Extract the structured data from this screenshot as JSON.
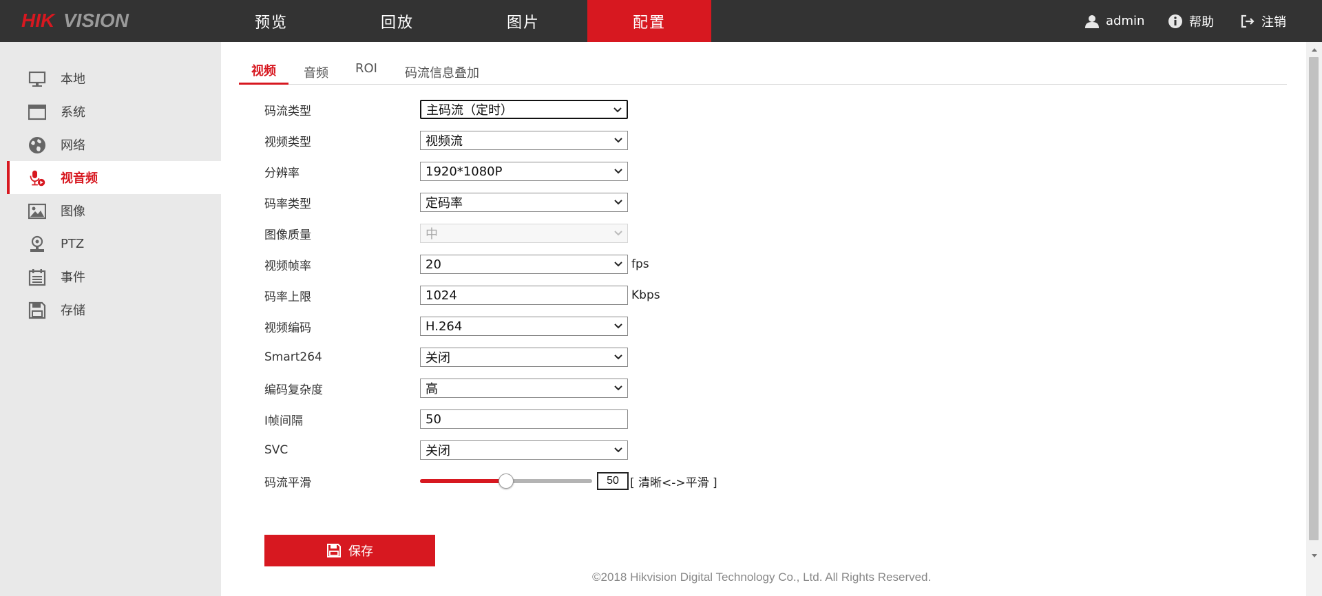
{
  "brand": {
    "logo_text": "HIKVISION",
    "accent": "#d71820"
  },
  "top_nav": {
    "tabs": [
      "预览",
      "回放",
      "图片",
      "配置"
    ],
    "active_tab": "配置",
    "user": "admin",
    "help": "帮助",
    "logout": "注销"
  },
  "sidebar": {
    "items": [
      {
        "label": "本地",
        "icon": "monitor-icon"
      },
      {
        "label": "系统",
        "icon": "window-icon"
      },
      {
        "label": "网络",
        "icon": "globe-icon"
      },
      {
        "label": "视音频",
        "icon": "mic-play-icon",
        "active": true
      },
      {
        "label": "图像",
        "icon": "image-icon"
      },
      {
        "label": "PTZ",
        "icon": "ptz-camera-icon"
      },
      {
        "label": "事件",
        "icon": "calendar-icon"
      },
      {
        "label": "存储",
        "icon": "floppy-icon"
      }
    ]
  },
  "subtabs": {
    "items": [
      "视频",
      "音频",
      "ROI",
      "码流信息叠加"
    ],
    "active": "视频"
  },
  "form": {
    "stream_type": {
      "label": "码流类型",
      "value": "主码流（定时）"
    },
    "video_type": {
      "label": "视频类型",
      "value": "视频流"
    },
    "resolution": {
      "label": "分辨率",
      "value": "1920*1080P"
    },
    "bitrate_type": {
      "label": "码率类型",
      "value": "定码率"
    },
    "image_quality": {
      "label": "图像质量",
      "value": "中",
      "disabled": true
    },
    "frame_rate": {
      "label": "视频帧率",
      "value": "20",
      "unit": "fps"
    },
    "max_bitrate": {
      "label": "码率上限",
      "value": "1024",
      "unit": "Kbps"
    },
    "video_encoding": {
      "label": "视频编码",
      "value": "H.264"
    },
    "smart264": {
      "label": "Smart264",
      "value": "关闭"
    },
    "encoding_complexity": {
      "label": "编码复杂度",
      "value": "高"
    },
    "i_frame_interval": {
      "label": "I帧间隔",
      "value": "50"
    },
    "svc": {
      "label": "SVC",
      "value": "关闭"
    },
    "stream_smoothing": {
      "label": "码流平滑",
      "value": "50",
      "level": 0.5,
      "hint": "[ 清晰<->平滑 ]"
    }
  },
  "save_button": "保存",
  "footer": "©2018 Hikvision Digital Technology Co., Ltd. All Rights Reserved."
}
